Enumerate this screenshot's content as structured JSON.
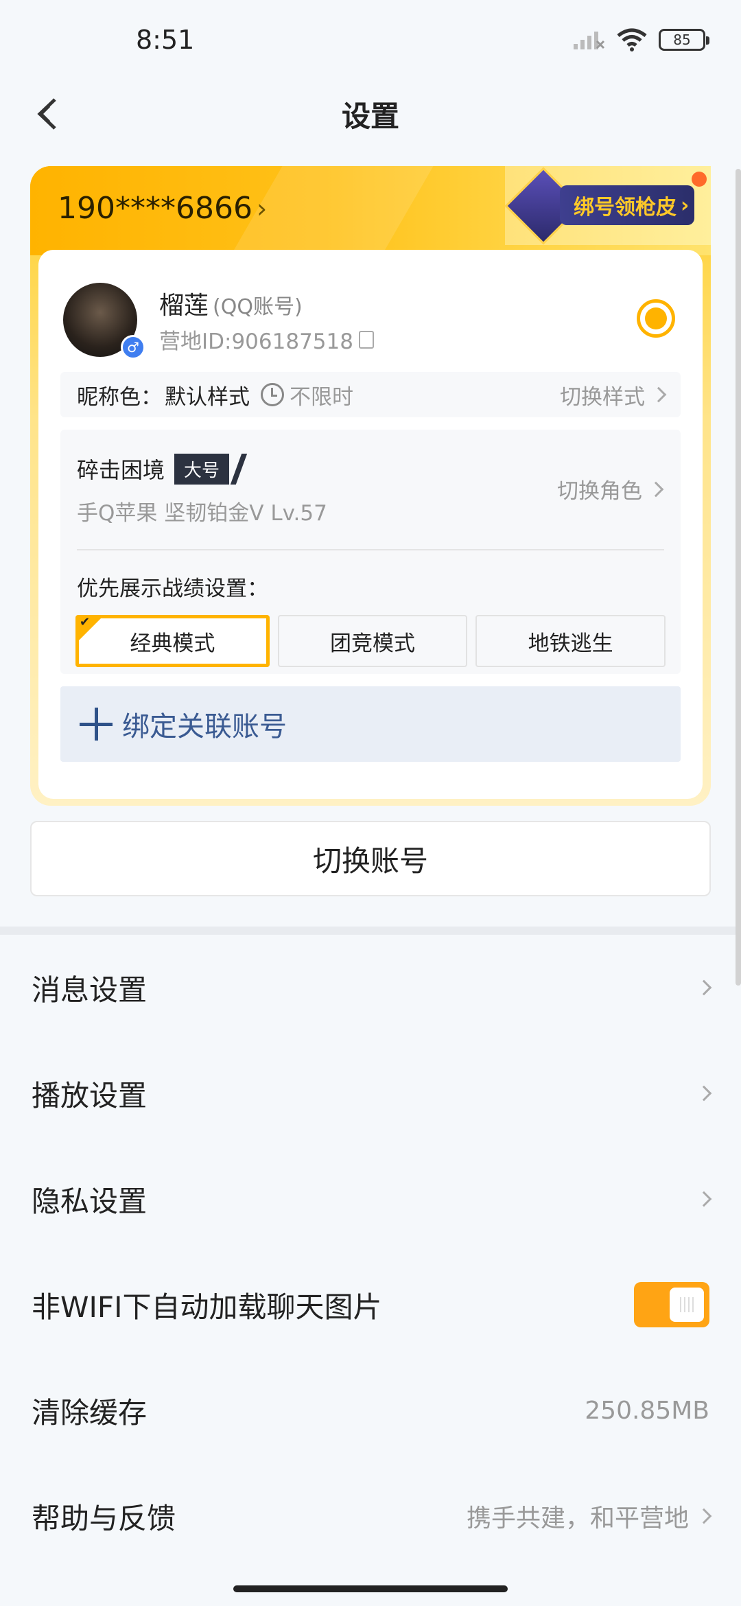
{
  "status_bar": {
    "time": "8:51",
    "battery": "85"
  },
  "header": {
    "title": "设置"
  },
  "account_card": {
    "phone": "190****6866",
    "promo_label": "绑号领枪皮",
    "user_name": "榴莲",
    "account_type": "(QQ账号)",
    "camp_id": "营地ID:906187518",
    "nick_color": {
      "label": "昵称色：",
      "value": "默认样式",
      "time_limit": "不限时",
      "switch_label": "切换样式"
    },
    "role": {
      "name": "碎击困境",
      "tag": "大号",
      "meta": "手Q苹果   坚韧铂金V   Lv.57",
      "switch_label": "切换角色"
    },
    "performance_label": "优先展示战绩设置：",
    "modes": [
      {
        "label": "经典模式",
        "active": true
      },
      {
        "label": "团竞模式",
        "active": false
      },
      {
        "label": "地铁逃生",
        "active": false
      }
    ],
    "bind_label": "绑定关联账号"
  },
  "switch_account_label": "切换账号",
  "settings": [
    {
      "label": "消息设置",
      "value": ""
    },
    {
      "label": "播放设置",
      "value": ""
    },
    {
      "label": "隐私设置",
      "value": ""
    },
    {
      "label": "非WIFI下自动加载聊天图片",
      "value": "",
      "toggle": true
    },
    {
      "label": "清除缓存",
      "value": "250.85MB"
    },
    {
      "label": "帮助与反馈",
      "value": "携手共建，和平营地"
    }
  ],
  "colors": {
    "accent": "#ffb300",
    "toggle": "#ffa414",
    "link": "#3a5a92"
  },
  "icons": [
    "back-arrow-icon",
    "signal-icon",
    "wifi-icon",
    "battery-icon",
    "chevron-right-icon",
    "copy-icon",
    "clock-icon",
    "plus-icon",
    "gender-male-icon"
  ]
}
